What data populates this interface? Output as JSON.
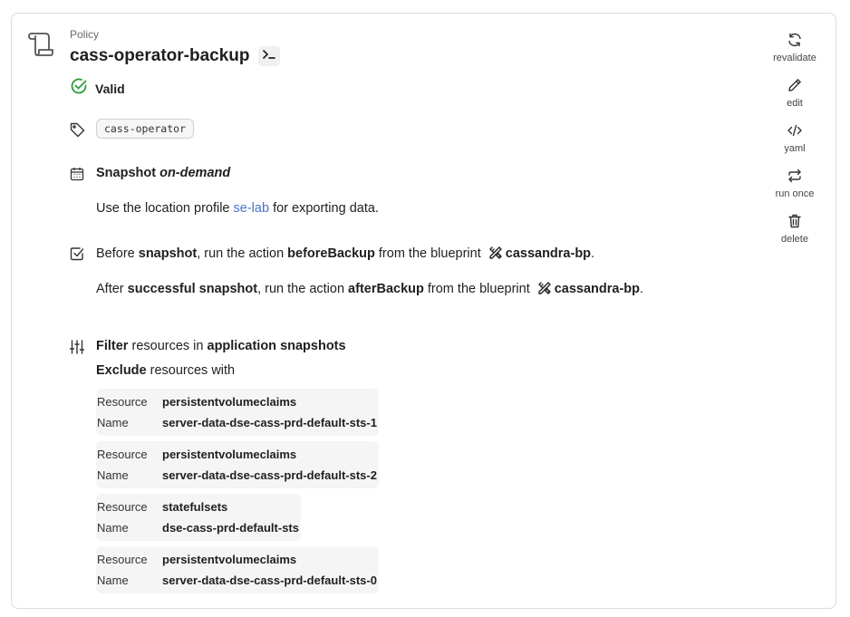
{
  "header": {
    "kind": "Policy",
    "title": "cass-operator-backup",
    "terminal_icon": "terminal-icon",
    "policy_icon": "scroll-icon"
  },
  "status": {
    "text": "Valid",
    "icon": "check-circle-icon",
    "color": "#2e9a3c"
  },
  "labels": {
    "icon": "tag-icon",
    "tag": "cass-operator"
  },
  "snapshot": {
    "icon": "calendar-icon",
    "title_prefix": "Snapshot",
    "frequency": "on-demand",
    "location_prefix": "Use the location profile",
    "location_profile": "se-lab",
    "location_suffix": "for exporting data."
  },
  "hooks": {
    "icon": "checkbox-icon",
    "before": {
      "p1": "Before",
      "event": "snapshot",
      "p2": ", run the action",
      "action": "beforeBackup",
      "p3": "from the blueprint",
      "blueprint": "cassandra-bp",
      "end": "."
    },
    "after": {
      "p1": "After",
      "event": "successful snapshot",
      "p2": ", run the action",
      "action": "afterBackup",
      "p3": "from the blueprint",
      "blueprint": "cassandra-bp",
      "end": "."
    }
  },
  "filter": {
    "icon": "sliders-icon",
    "w1": "Filter",
    "w2": "resources in",
    "w3": "application snapshots",
    "exclude_word": "Exclude",
    "exclude_rest": "resources with",
    "resource_label": "Resource",
    "name_label": "Name",
    "rules": [
      {
        "resource": "persistentvolumeclaims",
        "name": "server-data-dse-cass-prd-default-sts-1"
      },
      {
        "resource": "persistentvolumeclaims",
        "name": "server-data-dse-cass-prd-default-sts-2"
      },
      {
        "resource": "statefulsets",
        "name": "dse-cass-prd-default-sts"
      },
      {
        "resource": "persistentvolumeclaims",
        "name": "server-data-dse-cass-prd-default-sts-0"
      }
    ]
  },
  "actions": [
    {
      "label": "revalidate",
      "icon": "refresh-icon"
    },
    {
      "label": "edit",
      "icon": "pencil-icon"
    },
    {
      "label": "yaml",
      "icon": "code-icon"
    },
    {
      "label": "run once",
      "icon": "repeat-icon"
    },
    {
      "label": "delete",
      "icon": "trash-icon"
    }
  ]
}
